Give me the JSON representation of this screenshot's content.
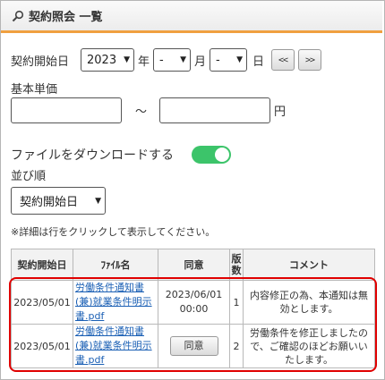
{
  "header": {
    "title": "契約照会 一覧",
    "icon": "magnifier-icon"
  },
  "filters": {
    "start_date_label": "契約開始日",
    "year_value": "2023",
    "year_unit": "年",
    "month_value": "-",
    "month_unit": "月",
    "day_value": "-",
    "day_unit": "日",
    "prev_label": "<<",
    "next_label": ">>",
    "base_price_label": "基本単価",
    "range_sep": "～",
    "yen_unit": "円",
    "download_label": "ファイルをダウンロードする",
    "download_toggle": "on",
    "sort_label": "並び順",
    "sort_value": "契約開始日",
    "hint": "※詳細は行をクリックして表示してください。"
  },
  "table": {
    "headers": {
      "start_date": "契約開始日",
      "file_name": "ﾌｧｲﾙ名",
      "agree": "同意",
      "version": "版数",
      "comment": "コメント"
    },
    "rows": [
      {
        "start_date": "2023/05/01",
        "file_name": "労働条件通知書(兼)就業条件明示書.pdf",
        "agree_date": "2023/06/01",
        "agree_time": "00:00",
        "version": "1",
        "comment": "内容修正の為、本通知は無効とします。"
      },
      {
        "start_date": "2023/05/01",
        "file_name": "労働条件通知書(兼)就業条件明示書.pdf",
        "agree_button": "同意",
        "version": "2",
        "comment": "労働条件を修正しましたので、ご確認のほどお願いいたします。"
      }
    ]
  },
  "colors": {
    "accent": "#f0a040",
    "toggle_on": "#3cc46a",
    "highlight": "#e00000",
    "link": "#1a5fb4"
  }
}
